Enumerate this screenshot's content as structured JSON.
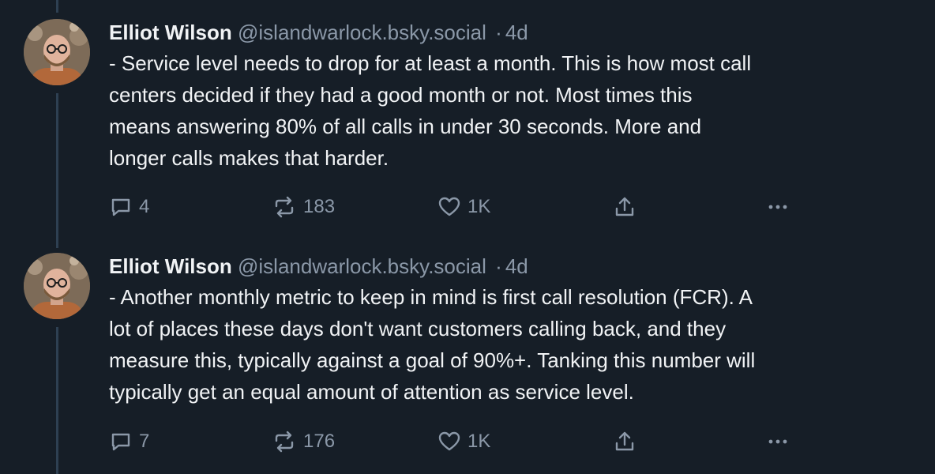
{
  "posts": [
    {
      "author_name": "Elliot Wilson",
      "handle": "@islandwarlock.bsky.social",
      "separator": "·",
      "time": "4d",
      "text_lines": [
        "- Service level needs to drop for at least a month. This is how most call",
        "centers decided if they had a good month or not. Most times this",
        "means answering 80% of all calls in under 30 seconds. More and",
        "longer calls makes that harder."
      ],
      "reply_count": "4",
      "repost_count": "183",
      "like_count": "1K",
      "icons": {
        "reply": "reply-icon",
        "repost": "repost-icon",
        "like": "heart-icon",
        "share": "share-icon",
        "more": "more-icon"
      }
    },
    {
      "author_name": "Elliot Wilson",
      "handle": "@islandwarlock.bsky.social",
      "separator": "·",
      "time": "4d",
      "text_lines": [
        "- Another monthly metric to keep in mind is first call resolution (FCR). A",
        "lot of places these days don't want customers calling back, and they",
        "measure this, typically against a goal of 90%+. Tanking this number will",
        "typically get an equal amount of attention as service level."
      ],
      "reply_count": "7",
      "repost_count": "176",
      "like_count": "1K",
      "icons": {
        "reply": "reply-icon",
        "repost": "repost-icon",
        "like": "heart-icon",
        "share": "share-icon",
        "more": "more-icon"
      }
    }
  ],
  "colors": {
    "background": "#161e27",
    "text": "#f1f3f5",
    "muted": "#8b98a8",
    "thread_line": "#2e4052"
  }
}
